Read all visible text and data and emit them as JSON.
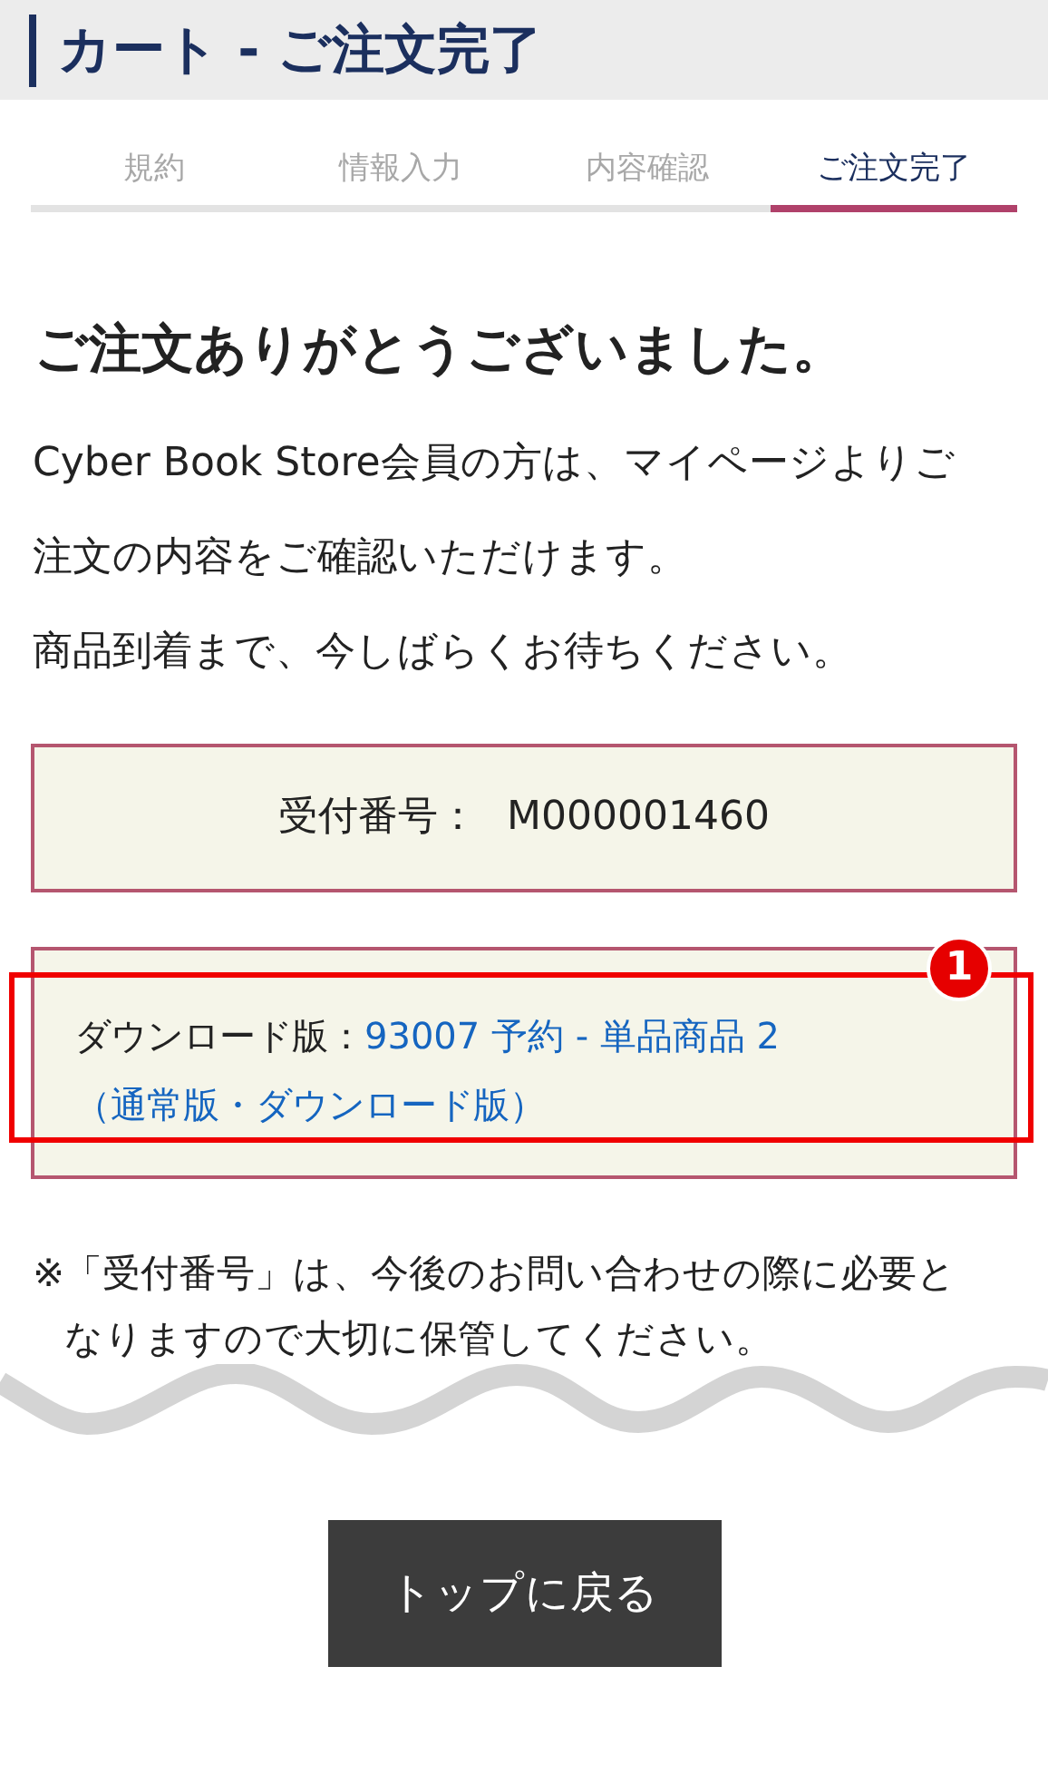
{
  "header": {
    "title": "カート - ご注文完了"
  },
  "steps": [
    {
      "label": "規約",
      "selected": false
    },
    {
      "label": "情報入力",
      "selected": false
    },
    {
      "label": "内容確認",
      "selected": false
    },
    {
      "label": "ご注文完了",
      "selected": true
    }
  ],
  "heading": "ご注文ありがとうございました。",
  "paragraphs": [
    "Cyber Book Store会員の方は、マイページよりご注文の内容をご確認いただけます。",
    "商品到着まで、今しばらくお待ちください。"
  ],
  "order_number": {
    "label": "受付番号：",
    "value": "M000001460"
  },
  "download": {
    "label": "ダウンロード版：",
    "link_lines": [
      "93007 予約 - 単品商品 2",
      "（通常版・ダウンロード版）"
    ]
  },
  "annotation": {
    "number": "1"
  },
  "note": {
    "mark": "※",
    "text": "「受付番号」は、今後のお問い合わせの際に必要となりますので大切に保管してください。"
  },
  "button": "トップに戻る"
}
